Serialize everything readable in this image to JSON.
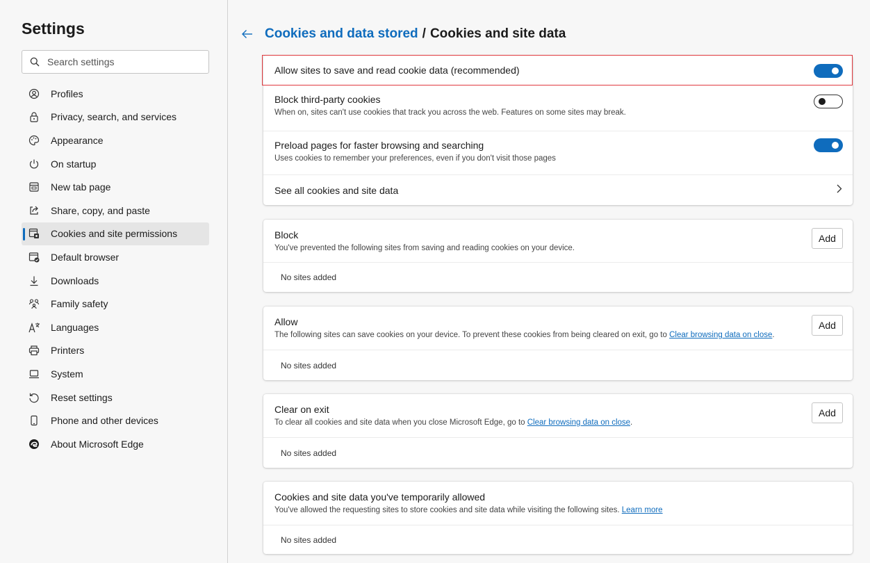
{
  "sidebar": {
    "title": "Settings",
    "search_placeholder": "Search settings",
    "items": [
      {
        "label": "Profiles",
        "icon": "profile-icon"
      },
      {
        "label": "Privacy, search, and services",
        "icon": "lock-icon"
      },
      {
        "label": "Appearance",
        "icon": "palette-icon"
      },
      {
        "label": "On startup",
        "icon": "power-icon"
      },
      {
        "label": "New tab page",
        "icon": "new-tab-icon"
      },
      {
        "label": "Share, copy, and paste",
        "icon": "share-icon"
      },
      {
        "label": "Cookies and site permissions",
        "icon": "cookies-icon",
        "active": true
      },
      {
        "label": "Default browser",
        "icon": "default-browser-icon"
      },
      {
        "label": "Downloads",
        "icon": "download-icon"
      },
      {
        "label": "Family safety",
        "icon": "family-icon"
      },
      {
        "label": "Languages",
        "icon": "languages-icon"
      },
      {
        "label": "Printers",
        "icon": "printer-icon"
      },
      {
        "label": "System",
        "icon": "laptop-icon"
      },
      {
        "label": "Reset settings",
        "icon": "reset-icon"
      },
      {
        "label": "Phone and other devices",
        "icon": "phone-icon"
      },
      {
        "label": "About Microsoft Edge",
        "icon": "edge-logo-icon"
      }
    ]
  },
  "header": {
    "breadcrumb_parent": "Cookies and data stored",
    "separator": "/",
    "title": "Cookies and site data"
  },
  "settings": {
    "allow_cookies": {
      "label": "Allow sites to save and read cookie data (recommended)",
      "on": true
    },
    "block_third_party": {
      "label": "Block third-party cookies",
      "desc": "When on, sites can't use cookies that track you across the web. Features on some sites may break.",
      "on": false
    },
    "preload": {
      "label": "Preload pages for faster browsing and searching",
      "desc": "Uses cookies to remember your preferences, even if you don't visit those pages",
      "on": true
    },
    "see_all": {
      "label": "See all cookies and site data"
    }
  },
  "block": {
    "title": "Block",
    "desc": "You've prevented the following sites from saving and reading cookies on your device.",
    "add_label": "Add",
    "empty": "No sites added"
  },
  "allow": {
    "title": "Allow",
    "desc": "The following sites can save cookies on your device. To prevent these cookies from being cleared on exit, go to ",
    "link": "Clear browsing data on close",
    "desc_end": ".",
    "add_label": "Add",
    "empty": "No sites added"
  },
  "clear_on_exit": {
    "title": "Clear on exit",
    "desc": "To clear all cookies and site data when you close Microsoft Edge, go to ",
    "link": "Clear browsing data on close",
    "desc_end": ".",
    "add_label": "Add",
    "empty": "No sites added"
  },
  "temporarily_allowed": {
    "title": "Cookies and site data you've temporarily allowed",
    "desc": "You've allowed the requesting sites to store cookies and site data while visiting the following sites. ",
    "link": "Learn more",
    "empty": "No sites added"
  },
  "colors": {
    "accent": "#0f6cbd",
    "highlight": "#e0393e"
  }
}
